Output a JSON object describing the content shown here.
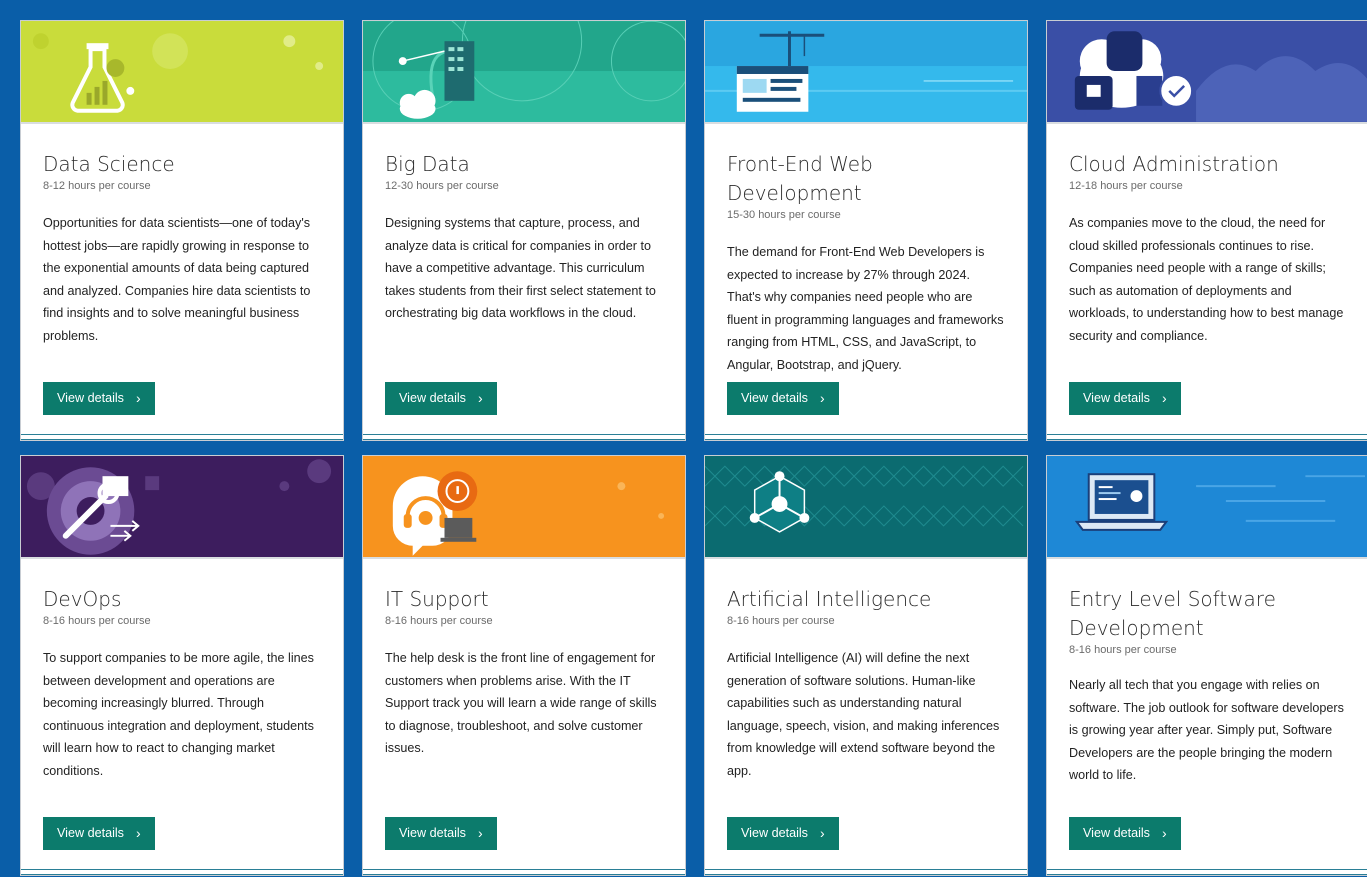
{
  "courses": [
    {
      "title": "Data Science",
      "hours": "8-12 hours per course",
      "description": "Opportunities for data scientists—one of today's hottest jobs—are rapidly growing in response to the exponential amounts of data being captured and analyzed. Companies hire data scientists to find insights and to solve meaningful business problems.",
      "button": "View details",
      "banner_color": "#c9dc3b",
      "icon": "flask-chart-icon"
    },
    {
      "title": "Big Data",
      "hours": "12-30 hours per course",
      "description": "Designing systems that capture, process, and analyze data is critical for companies in order to have a competitive advantage. This curriculum takes students from their first select statement to orchestrating big data workflows in the cloud.",
      "button": "View details",
      "banner_color": "#2dbb9e",
      "icon": "data-server-icon"
    },
    {
      "title": "Front-End Web Development",
      "hours": "15-30 hours per course",
      "description": "The demand for Front-End Web Developers is expected to increase by 27% through 2024. That's why companies need people who are fluent in programming languages and frameworks ranging from HTML, CSS, and JavaScript, to Angular, Bootstrap, and jQuery.",
      "button": "View details",
      "banner_color": "#34b9ec",
      "icon": "web-crane-icon"
    },
    {
      "title": "Cloud Administration",
      "hours": "12-18 hours per course",
      "description": "As companies move to the cloud, the need for cloud skilled professionals continues to rise. Companies need people with a range of skills; such as automation of deployments and workloads, to understanding how to best manage security and compliance.",
      "button": "View details",
      "banner_color": "#3a4fa6",
      "icon": "cloud-lock-icon"
    },
    {
      "title": "DevOps",
      "hours": "8-16 hours per course",
      "description": "To support companies to be more agile, the lines between development and operations are becoming increasingly blurred. Through continuous integration and deployment, students will learn how to react to changing market conditions.",
      "button": "View details",
      "banner_color": "#3d1d5e",
      "icon": "gear-wrench-icon"
    },
    {
      "title": "IT Support",
      "hours": "8-16 hours per course",
      "description": "The help desk is the front line of engagement for customers when problems arise. With the IT Support track you will learn a wide range of skills to diagnose, troubleshoot, and solve customer issues.",
      "button": "View details",
      "banner_color": "#f7931e",
      "icon": "headset-support-icon"
    },
    {
      "title": "Artificial Intelligence",
      "hours": "8-16 hours per course",
      "description": "Artificial Intelligence (AI) will define the next generation of software solutions. Human-like capabilities such as understanding natural language, speech, vision, and making inferences from knowledge will extend software beyond the app.",
      "button": "View details",
      "banner_color": "#0b6b70",
      "icon": "neural-network-icon"
    },
    {
      "title": "Entry Level Software Development",
      "hours": "8-16 hours per course",
      "description": "Nearly all tech that you engage with relies on software. The job outlook for software developers is growing year after year. Simply put, Software Developers are the people bringing the modern world to life.",
      "button": "View details",
      "banner_color": "#1e88d6",
      "icon": "laptop-code-icon"
    }
  ]
}
